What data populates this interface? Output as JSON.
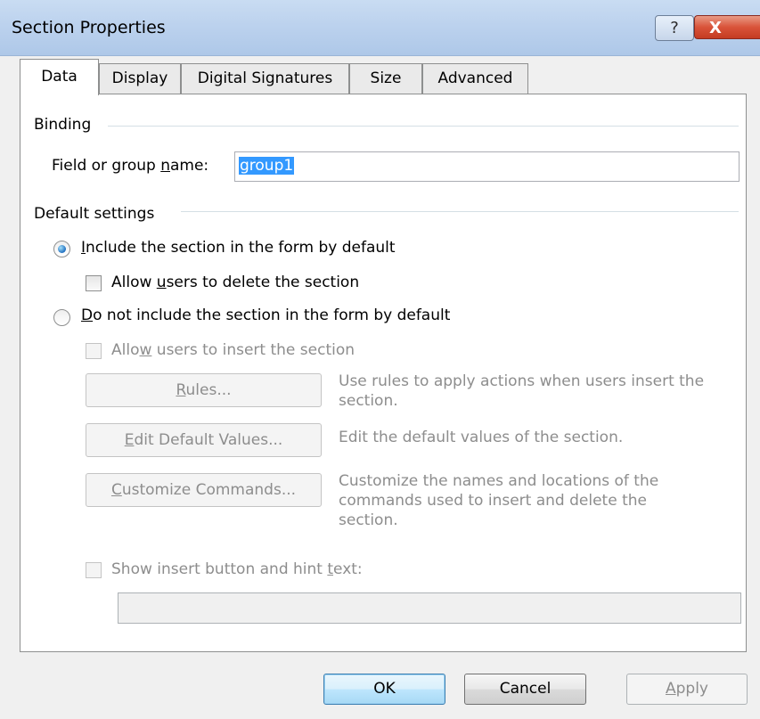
{
  "window": {
    "title": "Section Properties",
    "help_label": "?",
    "close_label": "X"
  },
  "tabs": [
    "Data",
    "Display",
    "Digital Signatures",
    "Size",
    "Advanced"
  ],
  "binding": {
    "group_label": "Binding",
    "field_label_pre": "Field or group ",
    "field_label_key": "n",
    "field_label_post": "ame:",
    "field_value": "group1"
  },
  "defaults": {
    "group_label": "Default settings",
    "include_key": "I",
    "include_rest": "nclude the section in the form by default",
    "include_checked": true,
    "allow_delete_pre": "Allow ",
    "allow_delete_key": "u",
    "allow_delete_post": "sers to delete the section",
    "allow_delete_checked": false,
    "not_include_key": "D",
    "not_include_rest": "o not include the section in the form by default",
    "allow_insert_pre": "Allo",
    "allow_insert_key": "w",
    "allow_insert_post": " users to insert the section",
    "rules_key": "R",
    "rules_rest": "ules...",
    "rules_desc": "Use rules to apply actions when users insert the section.",
    "edit_key": "E",
    "edit_rest": "dit Default Values...",
    "edit_desc": "Edit the default values of the section.",
    "customize_key": "C",
    "customize_rest": "ustomize Commands...",
    "customize_desc": "Customize the names and locations of the commands used to insert and delete the section.",
    "show_hint_pre": "Show insert button and hint ",
    "show_hint_key": "t",
    "show_hint_post": "ext:",
    "hint_value": ""
  },
  "footer": {
    "ok_label": "OK",
    "cancel_label": "Cancel",
    "apply_key": "A",
    "apply_rest": "pply"
  }
}
